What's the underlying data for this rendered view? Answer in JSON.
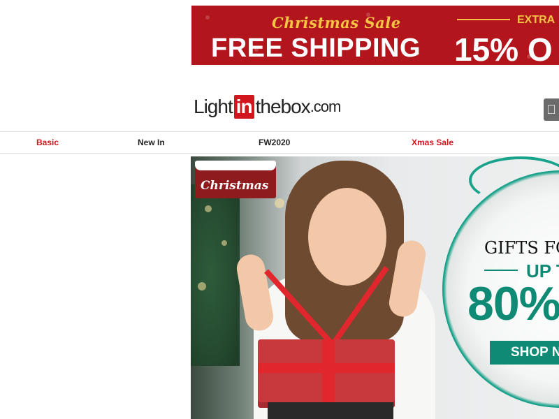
{
  "promo_banner": {
    "script_text": "Christmas Sale",
    "headline": "FREE SHIPPING",
    "extra_label": "EXTRA",
    "discount_text": "15% O",
    "colors": {
      "background": "#b3151c",
      "accent": "#f6c445"
    }
  },
  "logo": {
    "prefix": "Light",
    "badge": "in",
    "suffix": "thebox",
    "tld": ".com",
    "colors": {
      "badge": "#d2161e"
    }
  },
  "app_button": {
    "icon": "apple-icon"
  },
  "nav": {
    "items": [
      {
        "label": "Basic",
        "highlight": true
      },
      {
        "label": "New In",
        "highlight": false
      },
      {
        "label": "FW2020",
        "highlight": false
      },
      {
        "label": "Xmas Sale",
        "highlight": true
      }
    ]
  },
  "hero": {
    "tag_text": "Christmas",
    "headline": "GIFTS FO",
    "subline": "UP T",
    "discount": "80%",
    "cta_label": "SHOP N",
    "colors": {
      "accent": "#0f8a74"
    }
  }
}
